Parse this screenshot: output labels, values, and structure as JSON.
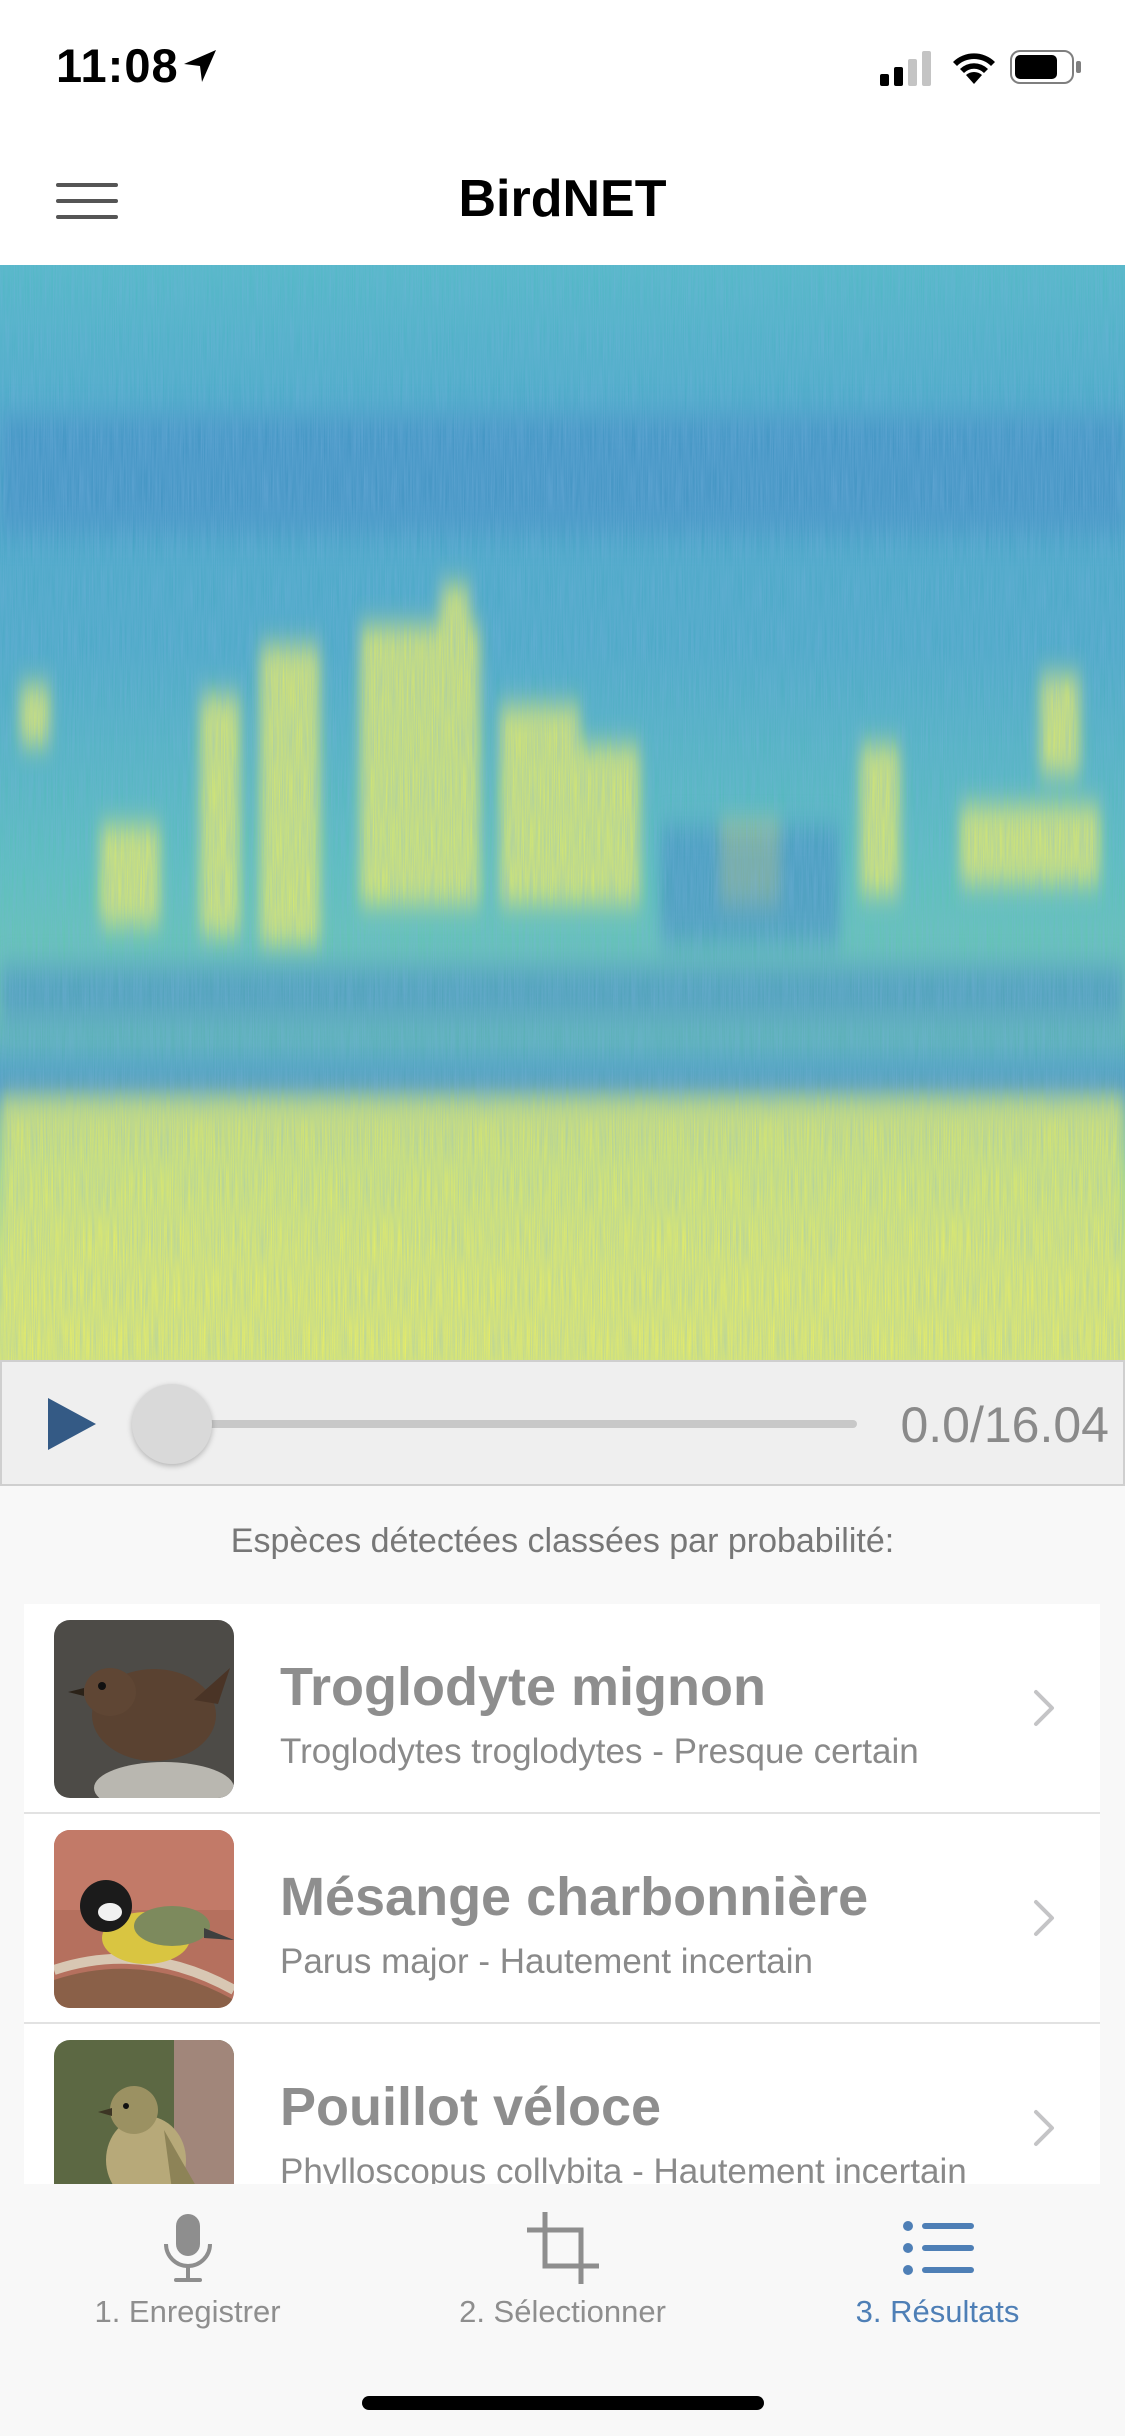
{
  "status_bar": {
    "time": "11:08"
  },
  "header": {
    "title": "BirdNET"
  },
  "colors": {
    "spectrogram_low": "#3e93c2",
    "spectrogram_mid": "#52c4c2",
    "spectrogram_high": "#f4f45c",
    "accent": "#4e7fb6",
    "play_button": "#345a85"
  },
  "player": {
    "time_readout": "0.0/16.04",
    "position_fraction": 0.0
  },
  "results": {
    "section_label": "Espèces détectées classées par probabilité:",
    "items": [
      {
        "common_name": "Troglodyte mignon",
        "subtitle": "Troglodytes troglodytes - Presque certain"
      },
      {
        "common_name": "Mésange charbonnière",
        "subtitle": "Parus major - Hautement incertain"
      },
      {
        "common_name": "Pouillot véloce",
        "subtitle": "Phylloscopus collybita - Hautement incertain"
      }
    ]
  },
  "tabs": [
    {
      "label": "1. Enregistrer",
      "icon": "microphone-icon",
      "active": false
    },
    {
      "label": "2. Sélectionner",
      "icon": "crop-icon",
      "active": false
    },
    {
      "label": "3. Résultats",
      "icon": "list-icon",
      "active": true
    }
  ]
}
